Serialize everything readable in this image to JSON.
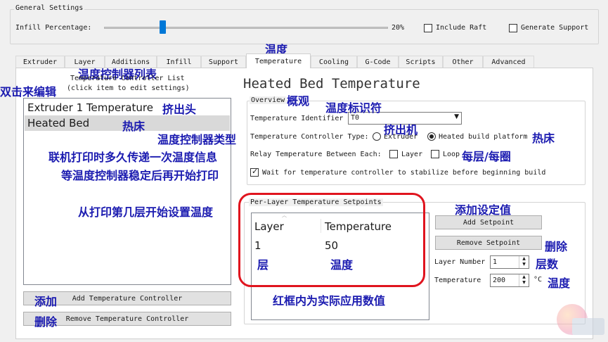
{
  "general": {
    "legend": "General Settings",
    "infill_label": "Infill Percentage:",
    "infill_value": "20%",
    "infill_fraction": 0.2,
    "include_raft": "Include Raft",
    "generate_support": "Generate Support"
  },
  "tabs": [
    "Extruder",
    "Layer",
    "Additions",
    "Infill",
    "Support",
    "Temperature",
    "Cooling",
    "G-Code",
    "Scripts",
    "Other",
    "Advanced"
  ],
  "active_tab": "Temperature",
  "left": {
    "header_line1": "Temperature Controller List",
    "header_line2": "(click item to edit settings)",
    "items": [
      "Extruder 1 Temperature",
      "Heated Bed"
    ],
    "add_button": "Add Temperature Controller",
    "remove_button": "Remove Temperature Controller"
  },
  "right": {
    "title": "Heated Bed Temperature",
    "overview_legend": "Overview",
    "identifier_label": "Temperature Identifier",
    "identifier_value": "T0",
    "controller_type_label": "Temperature Controller Type:",
    "type_extruder": "Extruder",
    "type_heated_bed": "Heated build platform",
    "relay_label": "Relay Temperature Between Each:",
    "relay_layer": "Layer",
    "relay_loop": "Loop",
    "wait_label": "Wait for temperature controller to stabilize before beginning build",
    "setpoints_legend": "Per-Layer Temperature Setpoints",
    "table_headers": [
      "Layer",
      "Temperature"
    ],
    "table_rows": [
      [
        "1",
        "50"
      ]
    ],
    "add_setpoint": "Add Setpoint",
    "remove_setpoint": "Remove Setpoint",
    "layer_number_label": "Layer Number",
    "layer_number_value": "1",
    "temperature_label": "Temperature",
    "temperature_value": "200",
    "temperature_unit": "°C"
  },
  "annotations": {
    "wendu_tab": "温度",
    "list_label": "温度控制器列表",
    "double_click": "双击来编辑",
    "extruder_head": "挤出头",
    "hot_bed_item": "热床",
    "overview": "概观",
    "identifier": "温度标识符",
    "extruder_machine": "挤出机",
    "hot_bed_radio": "热床",
    "controller_type": "温度控制器类型",
    "relay_info": "联机打印时多久传递一次温度信息",
    "multi_layer": "每层/每圈",
    "wait_info": "等温度控制器稳定后再开始打印",
    "start_layer": "从打印第几层开始设置温度",
    "add_setpoint": "添加设定值",
    "delete_setpoint": "删除",
    "layer_num": "层数",
    "temp": "温度",
    "col_layer": "层",
    "col_temp": "温度",
    "red_box_note": "红框内为实际应用数值",
    "add": "添加",
    "delete": "删除"
  },
  "colors": {
    "annotation": "#1b1bb0",
    "highlight_box": "#e0141e",
    "slider_thumb": "#0078d7"
  }
}
